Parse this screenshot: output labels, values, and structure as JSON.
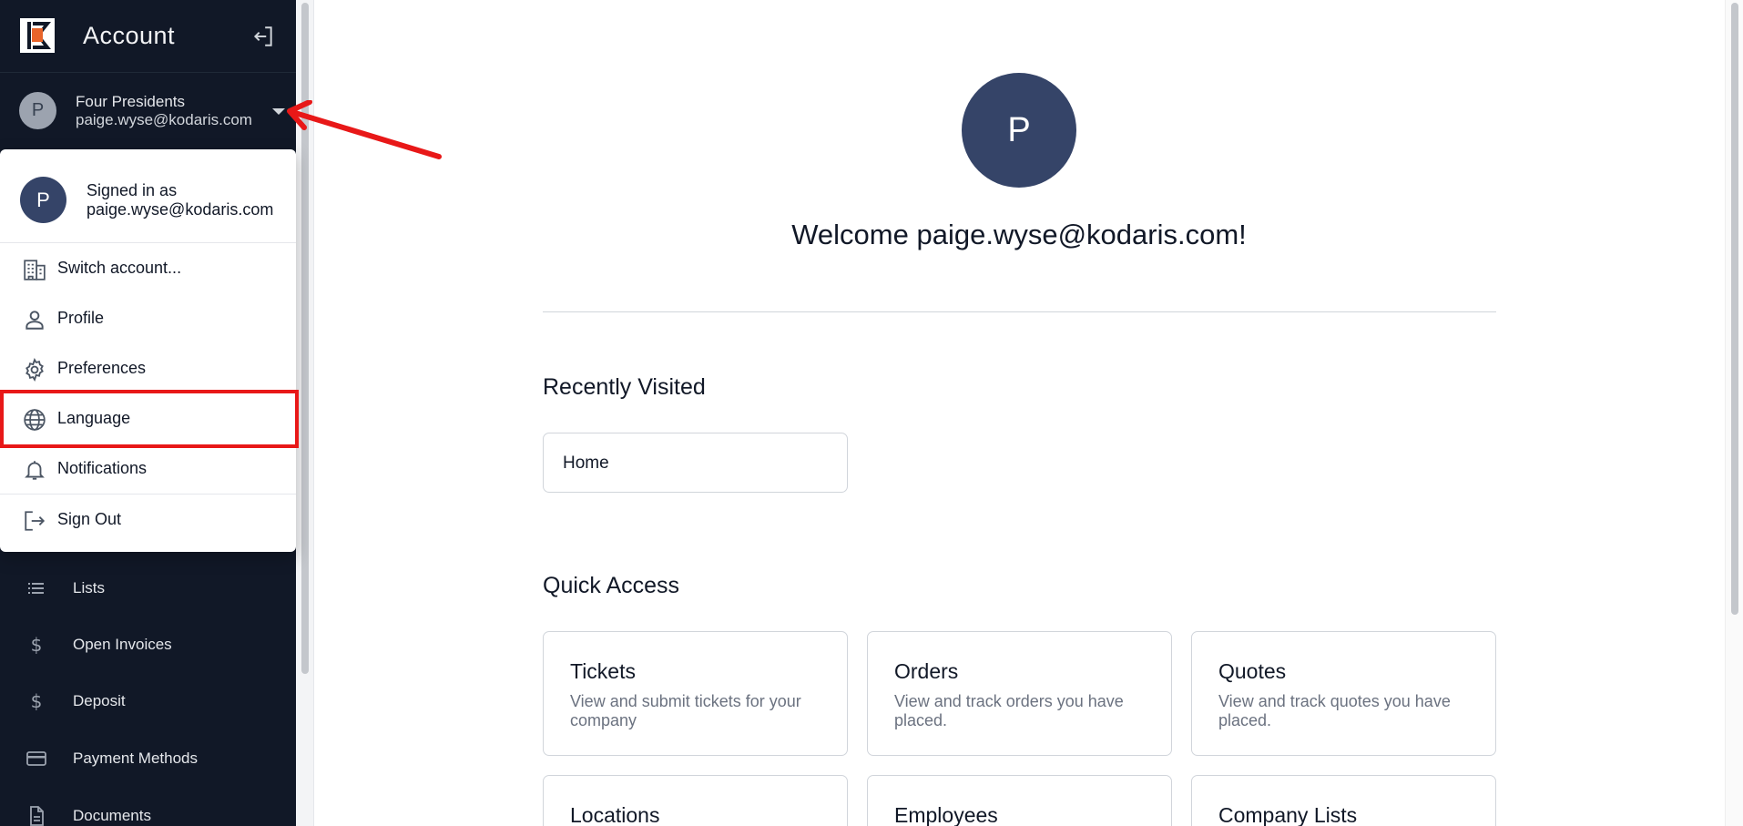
{
  "sidebar": {
    "title": "Account",
    "account": {
      "avatar_letter": "P",
      "name": "Four Presidents",
      "email": "paige.wyse@kodaris.com"
    },
    "nav_items": [
      {
        "label": "Lists",
        "icon": "list-icon"
      },
      {
        "label": "Open Invoices",
        "icon": "dollar-icon"
      },
      {
        "label": "Deposit",
        "icon": "dollar-icon"
      },
      {
        "label": "Payment Methods",
        "icon": "credit-card-icon"
      },
      {
        "label": "Documents",
        "icon": "document-icon"
      }
    ]
  },
  "menu": {
    "avatar_letter": "P",
    "signed_in_label": "Signed in as",
    "signed_in_email": "paige.wyse@kodaris.com",
    "items": [
      {
        "label": "Switch account...",
        "icon": "building-icon"
      },
      {
        "label": "Profile",
        "icon": "person-icon"
      },
      {
        "label": "Preferences",
        "icon": "gear-icon"
      },
      {
        "label": "Language",
        "icon": "globe-icon"
      },
      {
        "label": "Notifications",
        "icon": "bell-icon"
      },
      {
        "label": "Sign Out",
        "icon": "sign-out-icon"
      }
    ],
    "highlighted_item": "Language"
  },
  "main": {
    "avatar_letter": "P",
    "welcome": "Welcome paige.wyse@kodaris.com!",
    "recently_visited": {
      "title": "Recently Visited",
      "items": [
        "Home"
      ]
    },
    "quick_access": {
      "title": "Quick Access",
      "cards": [
        {
          "title": "Tickets",
          "description": "View and submit tickets for your company"
        },
        {
          "title": "Orders",
          "description": "View and track orders you have placed."
        },
        {
          "title": "Quotes",
          "description": "View and track quotes you have placed."
        },
        {
          "title": "Locations",
          "description": ""
        },
        {
          "title": "Employees",
          "description": ""
        },
        {
          "title": "Company Lists",
          "description": ""
        }
      ]
    }
  },
  "colors": {
    "sidebar_bg": "#111827",
    "avatar_bg": "#354468",
    "annotation_red": "#e81818",
    "logo_orange": "#e8642a"
  }
}
